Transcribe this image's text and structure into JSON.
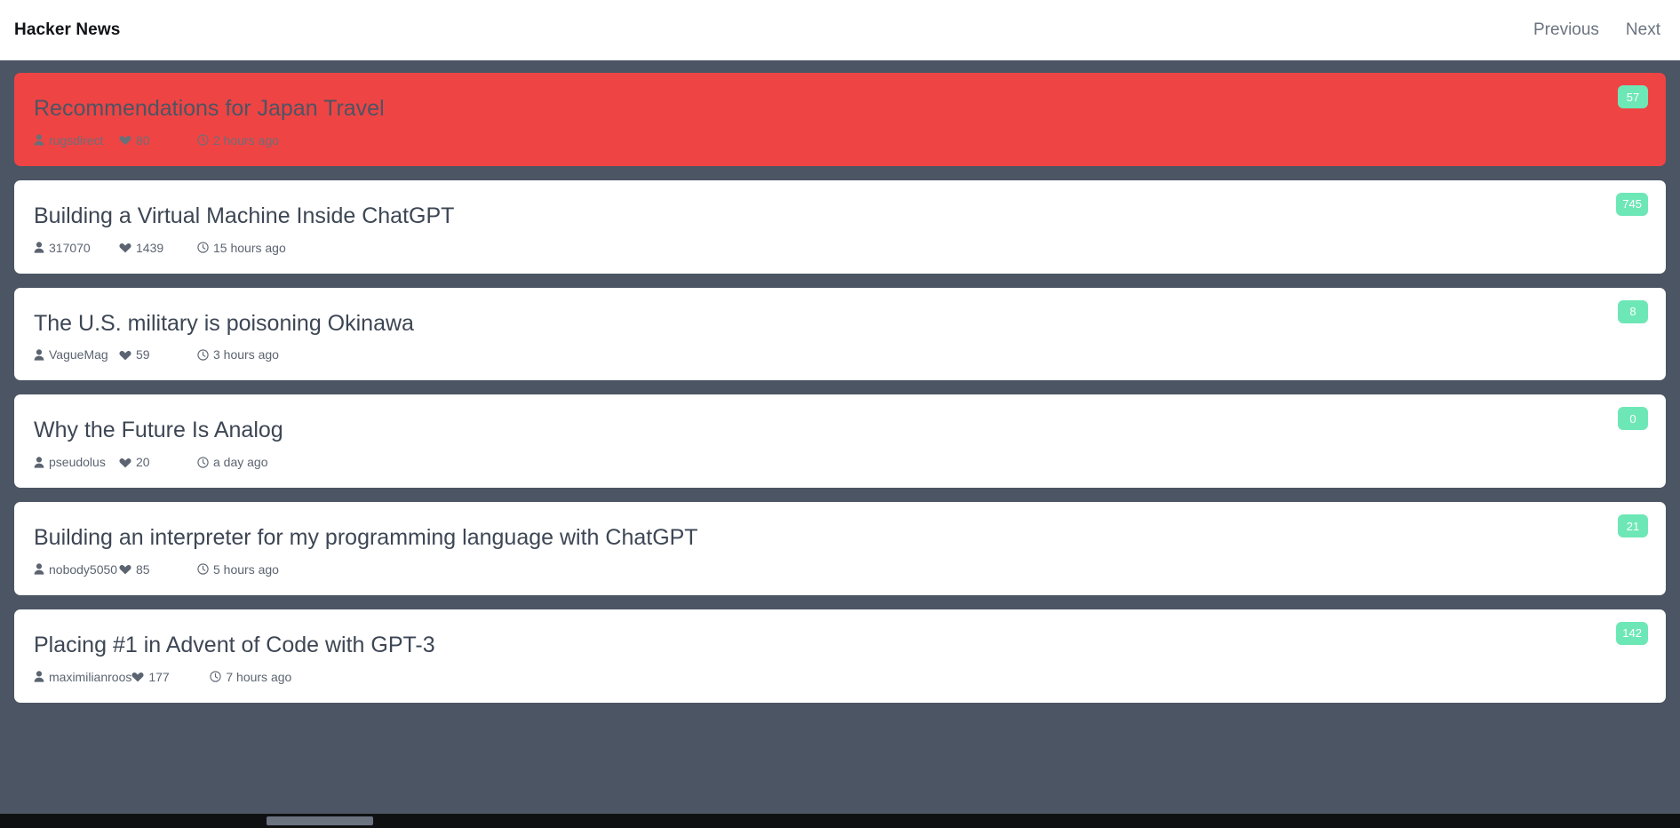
{
  "header": {
    "brand": "Hacker News",
    "nav": [
      {
        "label": "Previous",
        "name": "previous-link"
      },
      {
        "label": "Next",
        "name": "next-link"
      }
    ]
  },
  "colors": {
    "page_background": "#4b5563",
    "card_background": "#ffffff",
    "highlight_card": "#ef4444",
    "score_badge": "#6ee7b7",
    "title_text": "#3d4654",
    "meta_text": "#5b6470",
    "nav_link": "#6b7480"
  },
  "icons": {
    "author": "user-icon",
    "points": "heart-icon",
    "time": "clock-icon"
  },
  "stories": [
    {
      "title": "Recommendations for Japan Travel",
      "author": "rugsdirect",
      "points": "80",
      "time": "2 hours ago",
      "score": "57",
      "highlighted": true
    },
    {
      "title": "Building a Virtual Machine Inside ChatGPT",
      "author": "317070",
      "points": "1439",
      "time": "15 hours ago",
      "score": "745",
      "highlighted": false
    },
    {
      "title": "The U.S. military is poisoning Okinawa",
      "author": "VagueMag",
      "points": "59",
      "time": "3 hours ago",
      "score": "8",
      "highlighted": false
    },
    {
      "title": "Why the Future Is Analog",
      "author": "pseudolus",
      "points": "20",
      "time": "a day ago",
      "score": "0",
      "highlighted": false
    },
    {
      "title": "Building an interpreter for my programming language with ChatGPT",
      "author": "nobody5050",
      "points": "85",
      "time": "5 hours ago",
      "score": "21",
      "highlighted": false
    },
    {
      "title": "Placing #1 in Advent of Code with GPT-3",
      "author": "maximilianroos",
      "points": "177",
      "time": "7 hours ago",
      "score": "142",
      "highlighted": false
    }
  ]
}
